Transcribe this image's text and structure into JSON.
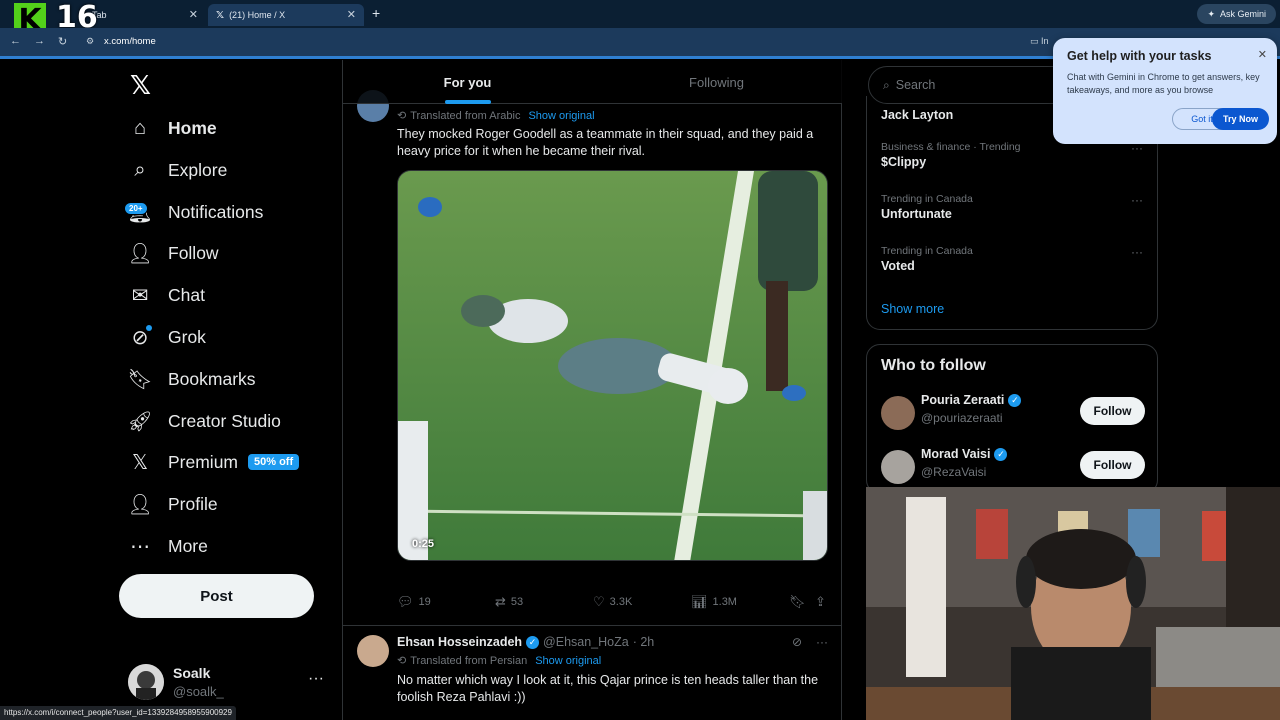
{
  "browser": {
    "overlay_number": "16",
    "overlay_logo_letter": "K",
    "tab1_title": "Tab",
    "tab2_title": "(21) Home / X",
    "url": "x.com/home",
    "install_label": "In",
    "ask_gemini_label": "Ask Gemini",
    "status_url": "https://x.com/i/connect_people?user_id=1339284958955900929"
  },
  "gemini_popup": {
    "title": "Get help with your tasks",
    "description": "Chat with Gemini in Chrome to get answers, key takeaways, and more as you browse",
    "got_it": "Got it",
    "try_now": "Try Now"
  },
  "sidebar": {
    "items": [
      {
        "label": "Home",
        "icon": "home-icon"
      },
      {
        "label": "Explore",
        "icon": "search-icon"
      },
      {
        "label": "Notifications",
        "icon": "bell-icon",
        "badge": "20+"
      },
      {
        "label": "Follow",
        "icon": "person-plus-icon"
      },
      {
        "label": "Chat",
        "icon": "mail-icon"
      },
      {
        "label": "Grok",
        "icon": "grok-icon"
      },
      {
        "label": "Bookmarks",
        "icon": "bookmark-icon"
      },
      {
        "label": "Creator Studio",
        "icon": "rocket-icon"
      },
      {
        "label": "Premium",
        "icon": "x-icon",
        "badge": "50% off"
      },
      {
        "label": "Profile",
        "icon": "person-icon"
      },
      {
        "label": "More",
        "icon": "more-circle-icon"
      }
    ],
    "post_button": "Post",
    "account": {
      "name": "Soalk",
      "handle": "@soalk_"
    }
  },
  "feed": {
    "tabs": [
      "For you",
      "Following"
    ],
    "post1": {
      "translated_from": "Translated from Arabic",
      "show_original": "Show original",
      "text": "They mocked Roger Goodell as a teammate in their squad, and they paid a heavy price for it when he became their rival.",
      "video_duration": "0:25",
      "replies": "19",
      "reposts": "53",
      "likes": "3.3K",
      "views": "1.3M"
    },
    "post2": {
      "name": "Ehsan Hosseinzadeh",
      "handle": "@Ehsan_HoZa",
      "time": "· 2h",
      "translated_from": "Translated from Persian",
      "show_original": "Show original",
      "text": "No matter which way I look at it, this Qajar prince is ten heads taller than the foolish Reza Pahlavi :))"
    }
  },
  "right": {
    "search_placeholder": "Search",
    "trends": [
      {
        "context": "",
        "name": "Jack Layton"
      },
      {
        "context": "Business & finance · Trending",
        "name": "$Clippy"
      },
      {
        "context": "Trending in Canada",
        "name": "Unfortunate"
      },
      {
        "context": "Trending in Canada",
        "name": "Voted"
      }
    ],
    "show_more": "Show more",
    "who_to_follow": {
      "title": "Who to follow",
      "users": [
        {
          "name": "Pouria Zeraati",
          "handle": "@pouriazeraati",
          "button": "Follow"
        },
        {
          "name": "Morad Vaisi",
          "handle": "@RezaVaisi",
          "button": "Follow"
        }
      ]
    }
  },
  "colors": {
    "accent": "#1d9bf0",
    "background": "#000000",
    "border": "#2f3336",
    "muted": "#71767b"
  }
}
